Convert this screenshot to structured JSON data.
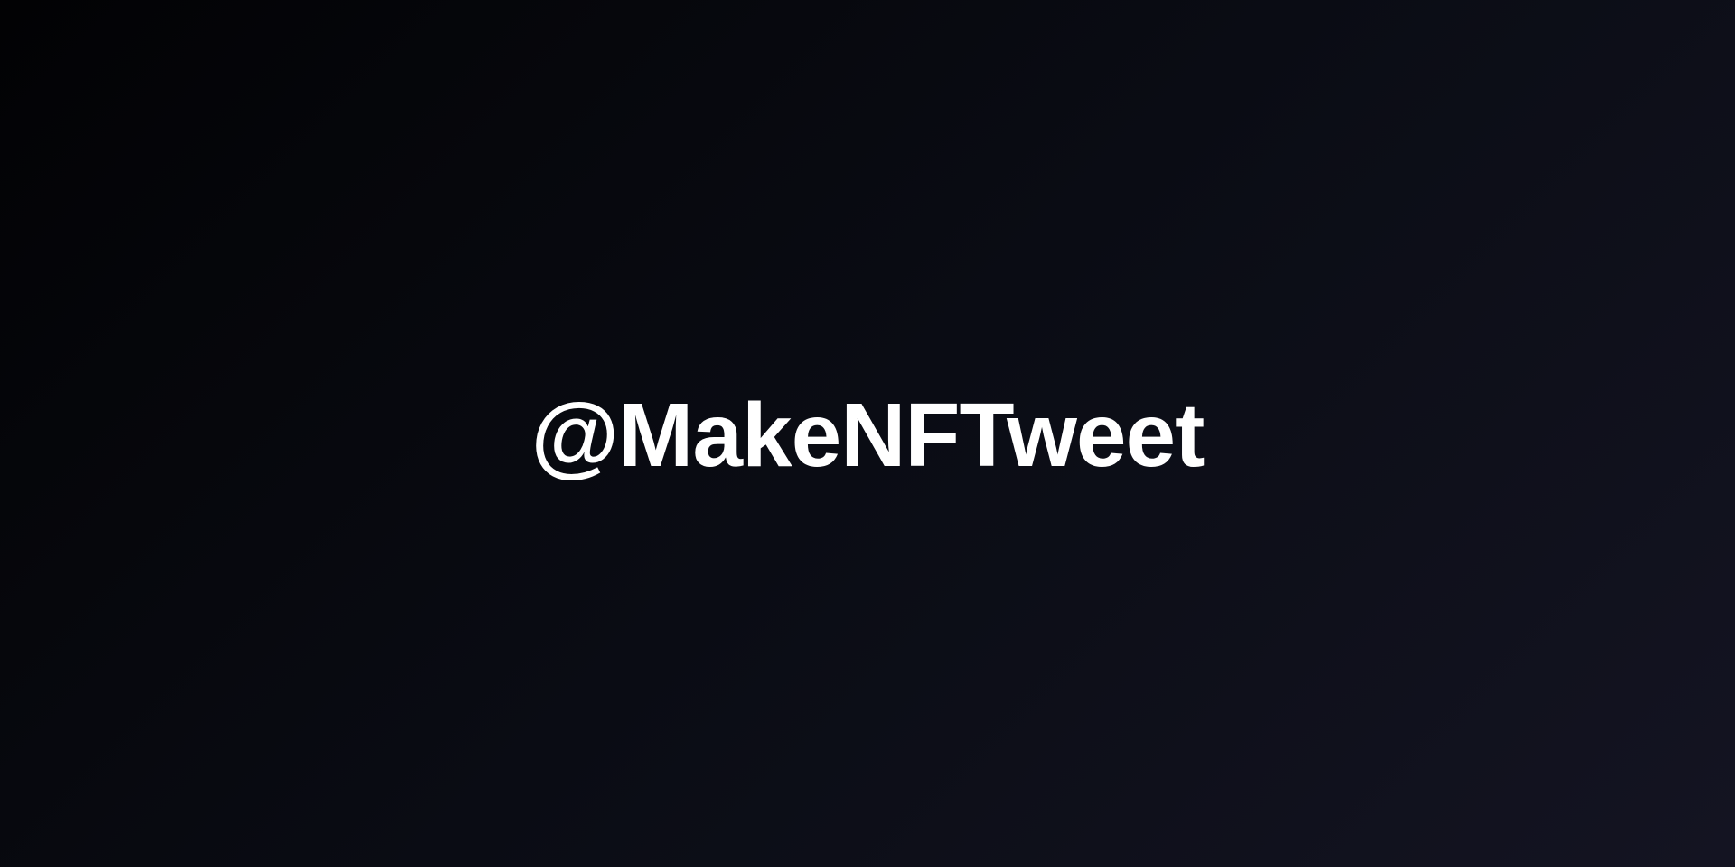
{
  "banner": {
    "handle": "@MakeNFTweet"
  },
  "colors": {
    "background_start": "#020204",
    "background_mid": "#0a0c14",
    "background_end": "#141422",
    "text": "#ffffff"
  }
}
